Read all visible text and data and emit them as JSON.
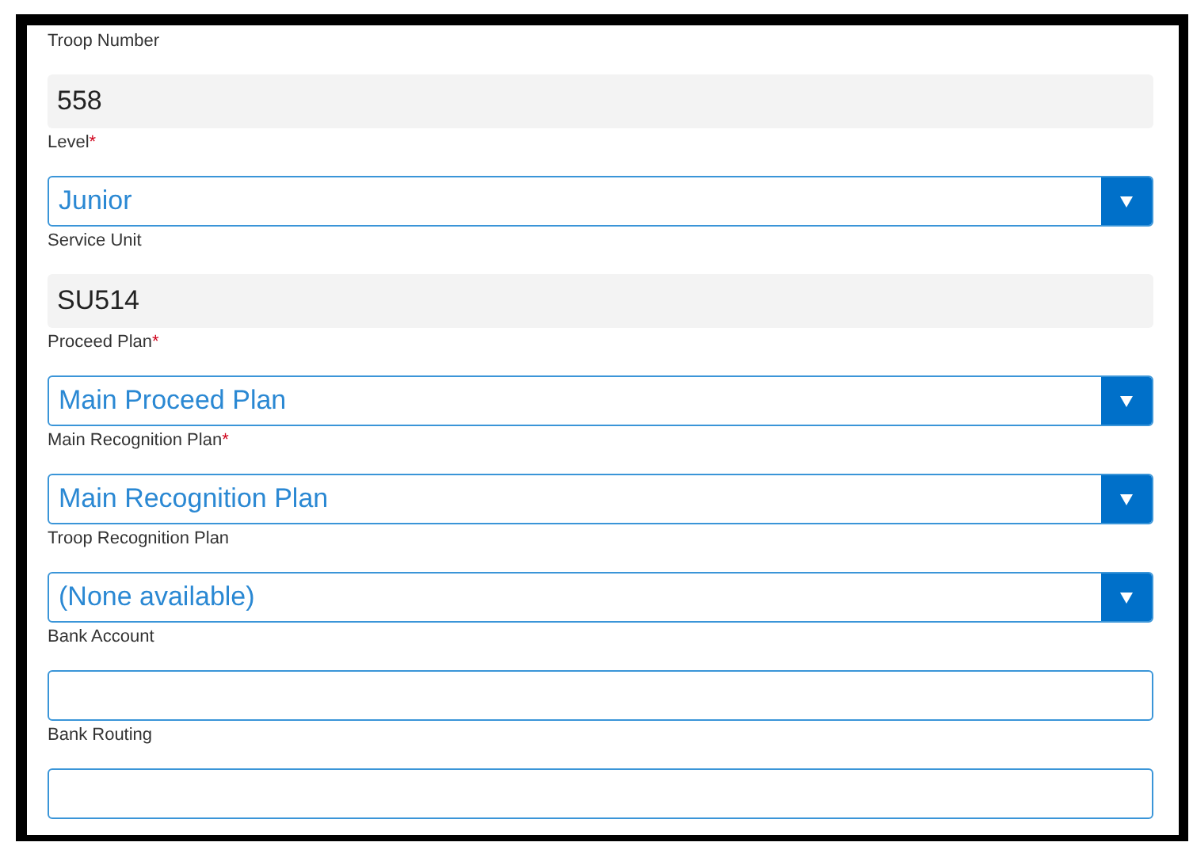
{
  "fields": [
    {
      "label": "Troop Number",
      "kind": "readonly",
      "value": "558"
    },
    {
      "label": "Level",
      "required_mark": "*",
      "kind": "select",
      "value": "Junior"
    },
    {
      "label": "Service Unit",
      "kind": "readonly",
      "value": "SU514"
    },
    {
      "label": "Proceed Plan",
      "required_mark": "*",
      "kind": "select",
      "value": "Main Proceed Plan"
    },
    {
      "label": "Main Recognition Plan",
      "required_mark": "*",
      "kind": "select",
      "value": "Main Recognition Plan"
    },
    {
      "label": "Troop Recognition Plan",
      "kind": "select",
      "value": "(None available)"
    },
    {
      "label": "Bank Account",
      "kind": "text"
    },
    {
      "label": "Bank Routing",
      "kind": "text"
    }
  ]
}
